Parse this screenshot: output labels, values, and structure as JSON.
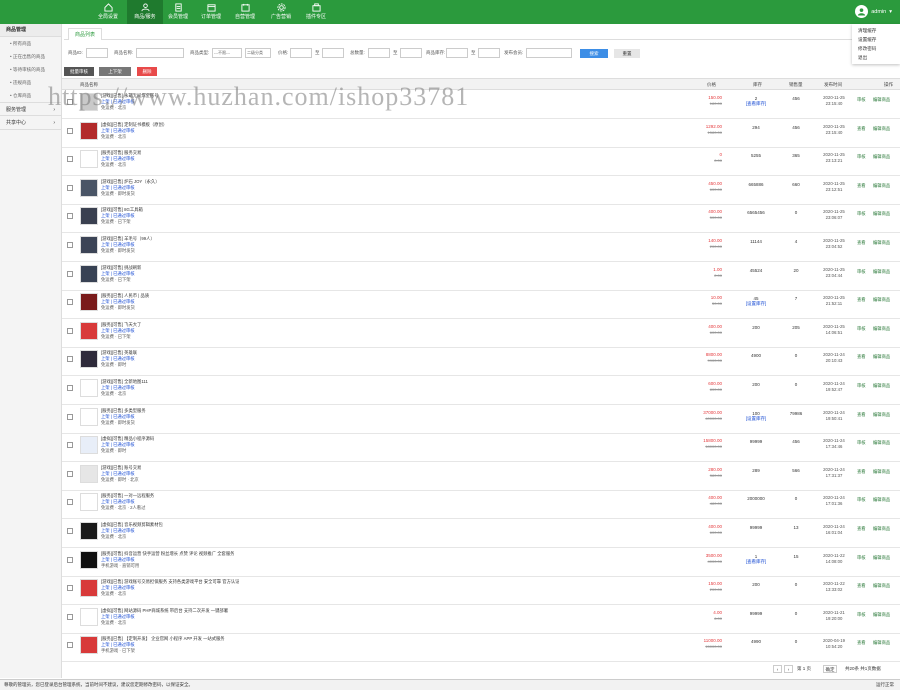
{
  "topbar": {
    "nav": [
      {
        "label": "全局设置",
        "icon": "home-icon"
      },
      {
        "label": "商品/服务",
        "icon": "user-icon"
      },
      {
        "label": "会员管理",
        "icon": "member-icon"
      },
      {
        "label": "订单管理",
        "icon": "order-icon"
      },
      {
        "label": "自营管理",
        "icon": "calendar-icon"
      },
      {
        "label": "广告营销",
        "icon": "gear-icon"
      },
      {
        "label": "插件专区",
        "icon": "plugin-icon"
      }
    ],
    "active_index": 1,
    "admin": "admin"
  },
  "dropdown": [
    "清理缓存",
    "设置缓存",
    "修改密码",
    "退出"
  ],
  "sidebar": {
    "header": "商品管理",
    "items": [
      "所有商品",
      "正在出售的商品",
      "等待审核的商品",
      "违规商品",
      "仓库商品"
    ],
    "groups": [
      "服务管理",
      "共享中心"
    ]
  },
  "tab": "商品列表",
  "filters": {
    "labels": [
      "商品ID:",
      "商品名称:",
      "商品类型:",
      "二级分类",
      "价格:",
      "至",
      "总数量:",
      "至",
      "商品库存:",
      "至",
      "发布会员:"
    ],
    "select1": "---不限---",
    "select2": "二级分类",
    "search": "搜索",
    "reset": "重置"
  },
  "actions": [
    "批量审核",
    "上下架",
    "删除"
  ],
  "table": {
    "headers": [
      "商品名称",
      "价格",
      "库存",
      "销售量",
      "发布时间",
      "操作"
    ],
    "rows": [
      {
        "l1": "[游戏][已售] 永劫无间炼金账号",
        "l2": "上架 | 已通过审核",
        "l3": "免运费 · 北京",
        "price": "150.00",
        "mprice": "180.00",
        "stock": "2",
        "stock2": "[查看库存]",
        "sold": "456",
        "date": "2020-11-25",
        "time": "23:15:40",
        "op1": "审核",
        "op2": "编辑商品",
        "thumb": "#c9c9c9"
      },
      {
        "l1": "[虚拟][已售] 定制证书模板（原创）",
        "l2": "上架 | 已通过审核",
        "l3": "免运费 · 北京",
        "price": "1292.00",
        "mprice": "1580.00",
        "stock": "294",
        "stock2": "",
        "sold": "456",
        "date": "2020-11-25",
        "time": "23:15:40",
        "op1": "查看",
        "op2": "编辑商品",
        "thumb": "#b22a2a"
      },
      {
        "l1": "[服务][可售] 服务交易",
        "l2": "上架 | 已通过审核",
        "l3": "免运费 · 北京",
        "price": "0",
        "mprice": "0.00",
        "stock": "5255",
        "stock2": "",
        "sold": "365",
        "date": "2020-11-25",
        "time": "23:13:21",
        "op1": "审核",
        "op2": "编辑商品",
        "thumb": "#ffffff"
      },
      {
        "l1": "[游戏][已售] 炉石 JOY（永久）",
        "l2": "上架 | 已通过审核",
        "l3": "免运费 · 即时发货",
        "price": "450.00",
        "mprice": "600.00",
        "stock": "665886",
        "stock2": "",
        "sold": "660",
        "date": "2020-11-25",
        "time": "23:12:51",
        "op1": "查看",
        "op2": "编辑商品",
        "thumb": "#4a5566"
      },
      {
        "l1": "[游戏][可售] 8G工具箱",
        "l2": "上架 | 已通过审核",
        "l3": "免运费 · 已下架",
        "price": "400.00",
        "mprice": "500.00",
        "stock": "6565456",
        "stock2": "",
        "sold": "0",
        "date": "2020-11-25",
        "time": "23:06:07",
        "op1": "审核",
        "op2": "编辑商品",
        "thumb": "#3a4050"
      },
      {
        "l1": "[游戏][已售] 羊毛号（99人）",
        "l2": "上架 | 已通过审核",
        "l3": "免运费 · 即时发货",
        "price": "140.00",
        "mprice": "200.00",
        "stock": "11144",
        "stock2": "",
        "sold": "4",
        "date": "2020-11-25",
        "time": "23:04:52",
        "op1": "查看",
        "op2": "编辑商品",
        "thumb": "#3c4456"
      },
      {
        "l1": "[游戏][可售] 挑战刷新",
        "l2": "上架 | 已通过审核",
        "l3": "免运费 · 已下架",
        "price": "1.00",
        "mprice": "2.00",
        "stock": "45524",
        "stock2": "",
        "sold": "20",
        "date": "2020-11-25",
        "time": "23:04:44",
        "op1": "审核",
        "op2": "编辑商品",
        "thumb": "#384254"
      },
      {
        "l1": "[服务][已售] 人民币 | 品质",
        "l2": "上架 | 已通过审核",
        "l3": "免运费 · 即时发货",
        "price": "10.00",
        "mprice": "30.00",
        "stock": "45",
        "stock2": "[设置库存]",
        "sold": "7",
        "date": "2020-11-25",
        "time": "21:52:11",
        "op1": "查看",
        "op2": "编辑商品",
        "thumb": "#7a1b1b"
      },
      {
        "l1": "[服务][可售] 飞天大了",
        "l2": "上架 | 已通过审核",
        "l3": "免运费 · 已下架",
        "price": "400.00",
        "mprice": "600.00",
        "stock": "200",
        "stock2": "",
        "sold": "205",
        "date": "2020-11-25",
        "time": "14:06:51",
        "op1": "审核",
        "op2": "编辑商品",
        "thumb": "#d83a3a"
      },
      {
        "l1": "[游戏][已售] 英雄联",
        "l2": "上架 | 已通过审核",
        "l3": "免运费 · 即时",
        "price": "8800.00",
        "mprice": "9900.00",
        "stock": "4900",
        "stock2": "",
        "sold": "0",
        "date": "2020-11-24",
        "time": "20:10:43",
        "op1": "查看",
        "op2": "编辑商品",
        "thumb": "#2e2a3a"
      },
      {
        "l1": "[游戏][可售] 全新地图111",
        "l2": "上架 | 已通过审核",
        "l3": "免运费 · 北京",
        "price": "600.00",
        "mprice": "800.00",
        "stock": "200",
        "stock2": "",
        "sold": "0",
        "date": "2020-11-24",
        "time": "19:52:47",
        "op1": "审核",
        "op2": "编辑商品",
        "thumb": "#ffffff"
      },
      {
        "l1": "[服务][已售] 多类型服务",
        "l2": "上架 | 已通过审核",
        "l3": "免运费 · 即时发货",
        "price": "37000.00",
        "mprice": "40000.00",
        "stock": "100",
        "stock2": "[设置库存]",
        "sold": "79986",
        "date": "2020-11-24",
        "time": "19:50:41",
        "op1": "查看",
        "op2": "编辑商品",
        "thumb": "#ffffff"
      },
      {
        "l1": "[虚拟][可售] 精品小程序源码",
        "l2": "上架 | 已通过审核",
        "l3": "免运费 · 即时",
        "price": "15800.00",
        "mprice": "18000.00",
        "stock": "99999",
        "stock2": "",
        "sold": "456",
        "date": "2020-11-24",
        "time": "17:34:46",
        "op1": "审核",
        "op2": "编辑商品",
        "thumb": "#e8eef8"
      },
      {
        "l1": "[游戏][已售] 账号交易",
        "l2": "上架 | 已通过审核",
        "l3": "免运费 · 即时 · 北京",
        "price": "280.00",
        "mprice": "380.00",
        "stock": "289",
        "stock2": "",
        "sold": "566",
        "date": "2020-11-24",
        "time": "17:31:37",
        "op1": "查看",
        "op2": "编辑商品",
        "thumb": "#e6e6e6"
      },
      {
        "l1": "[服务][可售] 一对一远程服务",
        "l2": "上架 | 已通过审核",
        "l3": "免运费 · 北京 · 2人看过",
        "price": "400.00",
        "mprice": "480.00",
        "stock": "2000000",
        "stock2": "",
        "sold": "0",
        "date": "2020-11-24",
        "time": "17:01:36",
        "op1": "审核",
        "op2": "编辑商品",
        "thumb": "#ffffff"
      },
      {
        "l1": "[虚拟][已售] 音乐视频剪辑素材包",
        "l2": "上架 | 已通过审核",
        "l3": "免运费 · 北京",
        "price": "400.00",
        "mprice": "600.00",
        "stock": "99999",
        "stock2": "",
        "sold": "13",
        "date": "2020-11-24",
        "time": "16:01:04",
        "op1": "查看",
        "op2": "编辑商品",
        "thumb": "#1a1a1a"
      },
      {
        "l1": "[服务][可售] 抖音运营 快手运营 粉丝增长 点赞 评论 视频推广 全套服务",
        "l2": "上架 | 已通过审核",
        "l3": "手机游戏 · 直销可用",
        "price": "3500.00",
        "mprice": "4000.00",
        "stock": "1",
        "stock2": "[查看库存]",
        "sold": "15",
        "date": "2020-11-22",
        "time": "14:08:00",
        "op1": "审核",
        "op2": "编辑商品",
        "thumb": "#111111"
      },
      {
        "l1": "[游戏][已售] 游戏账号交易担保服务 支持各类游戏平台 安全可靠 官方认证",
        "l2": "上架 | 已通过审核",
        "l3": "免运费 · 北京",
        "price": "150.00",
        "mprice": "200.00",
        "stock": "200",
        "stock2": "",
        "sold": "0",
        "date": "2020-11-22",
        "time": "13:33:02",
        "op1": "查看",
        "op2": "编辑商品",
        "thumb": "#d83a3a"
      },
      {
        "l1": "[虚拟][可售] 网站源码 PHP商城系统 带后台 支持二次开发 一键部署",
        "l2": "上架 | 已通过审核",
        "l3": "免运费 · 北京",
        "price": "4.00",
        "mprice": "6.00",
        "stock": "99999",
        "stock2": "",
        "sold": "0",
        "date": "2020-11-21",
        "time": "19:20:00",
        "op1": "审核",
        "op2": "编辑商品",
        "thumb": "#ffffff"
      },
      {
        "l1": "[服务][已售] 【定制开发】 企业官网 小程序 APP 开发 一站式服务",
        "l2": "上架 | 已通过审核",
        "l3": "手机游戏 · 已下架",
        "price": "11000.00",
        "mprice": "15000.00",
        "stock": "4990",
        "stock2": "",
        "sold": "0",
        "date": "2020-04-19",
        "time": "10:54:20",
        "op1": "查看",
        "op2": "编辑商品",
        "thumb": "#d83a3a"
      }
    ]
  },
  "pager": {
    "page": "1",
    "total_label": "共1页",
    "summary": "共20条 共1页数据",
    "go": "确定"
  },
  "status": "尊敬的管理员，您已登录后台管理系统，当前时间不建议，建议您定期修改密码，以保证安全。",
  "status_right": "运行正常",
  "watermark": "https://www.huzhan.com/ishop33781",
  "colors": {
    "brand": "#2b9a3d",
    "price": "#e4393c",
    "link": "#1a4dd4"
  }
}
